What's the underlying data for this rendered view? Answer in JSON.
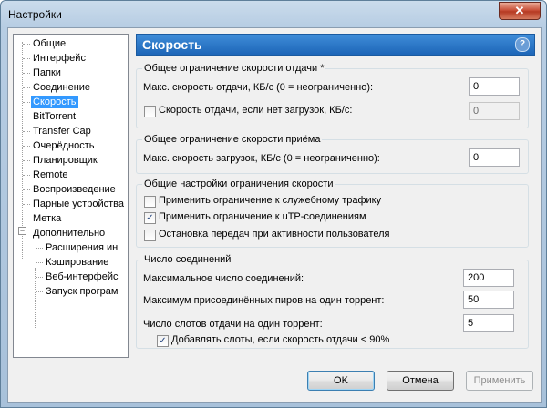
{
  "window": {
    "title": "Настройки",
    "close_glyph": "✕"
  },
  "sidebar": {
    "items": [
      {
        "label": "Общие"
      },
      {
        "label": "Интерфейс"
      },
      {
        "label": "Папки"
      },
      {
        "label": "Соединение"
      },
      {
        "label": "Скорость",
        "selected": true
      },
      {
        "label": "BitTorrent"
      },
      {
        "label": "Transfer Cap"
      },
      {
        "label": "Очерёдность"
      },
      {
        "label": "Планировщик"
      },
      {
        "label": "Remote"
      },
      {
        "label": "Воспроизведение"
      },
      {
        "label": "Парные устройства"
      },
      {
        "label": "Метка"
      },
      {
        "label": "Дополнительно",
        "expander": "−"
      },
      {
        "label": "Расширения ин"
      },
      {
        "label": "Кэширование"
      },
      {
        "label": "Веб-интерфейс"
      },
      {
        "label": "Запуск програм"
      }
    ]
  },
  "panel": {
    "title": "Скорость",
    "help_glyph": "?",
    "upload_group": {
      "title": "Общее ограничение скорости отдачи *",
      "max_upload_label": "Макс. скорость отдачи, КБ/с (0 = неограниченно):",
      "max_upload_value": "0",
      "idle_upload_label": "Скорость отдачи, если нет загрузок, КБ/с:",
      "idle_upload_checked": false,
      "idle_upload_value": "0"
    },
    "download_group": {
      "title": "Общее ограничение скорости приёма",
      "max_download_label": "Макс. скорость загрузок, КБ/с (0 = неограниченно):",
      "max_download_value": "0"
    },
    "general_group": {
      "title": "Общие настройки ограничения скорости",
      "apply_overhead_label": "Применить ограничение к служебному трафику",
      "apply_overhead_checked": false,
      "apply_utp_label": "Применить ограничение к uTP-соединениям",
      "apply_utp_checked": true,
      "stop_on_activity_label": "Остановка передач при активности пользователя",
      "stop_on_activity_checked": false
    },
    "connections_group": {
      "title": "Число соединений",
      "max_connections_label": "Максимальное число соединений:",
      "max_connections_value": "200",
      "max_peers_label": "Максимум присоединённых пиров на один торрент:",
      "max_peers_value": "50",
      "upload_slots_label": "Число слотов отдачи на один торрент:",
      "upload_slots_value": "5",
      "add_slots_label": "Добавлять слоты, если скорость отдачи < 90%",
      "add_slots_checked": true
    }
  },
  "buttons": {
    "ok": "OK",
    "cancel": "Отмена",
    "apply": "Применить"
  },
  "check_glyph": "✓"
}
